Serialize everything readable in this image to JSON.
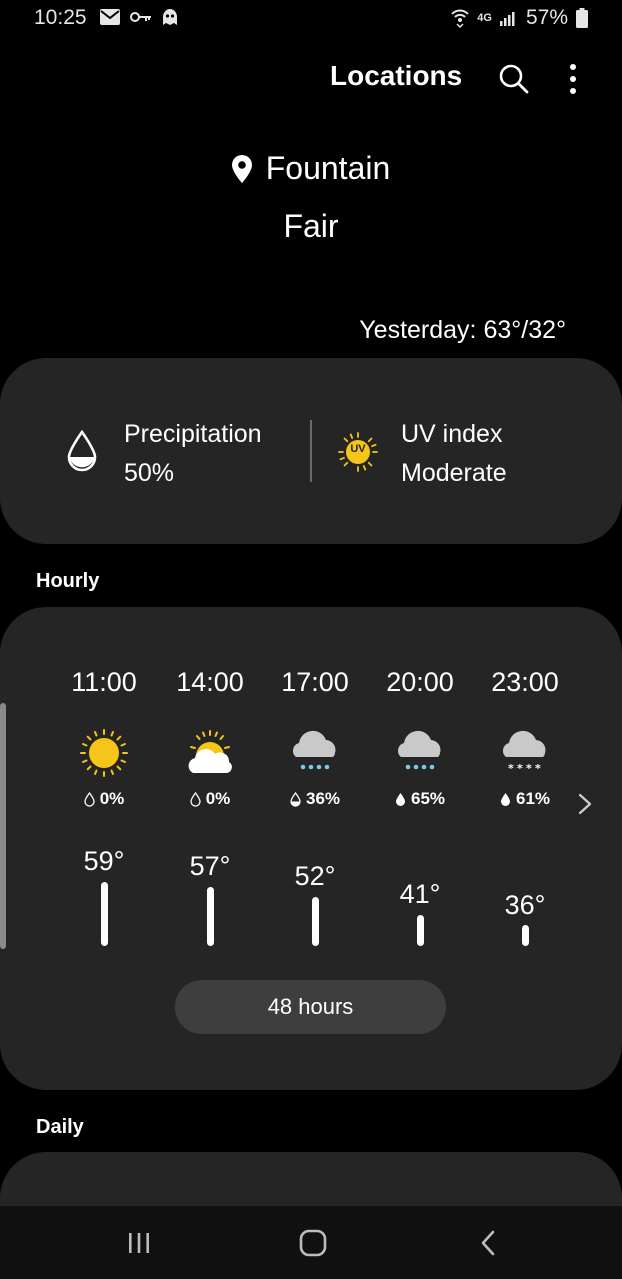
{
  "status_bar": {
    "time": "10:25",
    "network": "4G",
    "battery": "57%"
  },
  "header": {
    "title": "Locations"
  },
  "location": {
    "name": "Fountain",
    "condition": "Fair",
    "yesterday": "Yesterday: 63°/32°"
  },
  "info": {
    "precipitation_label": "Precipitation",
    "precipitation_value": "50%",
    "uv_label": "UV index",
    "uv_value": "Moderate",
    "uv_badge": "UV"
  },
  "hourly": {
    "title": "Hourly",
    "hours": [
      {
        "time": "11:00",
        "icon": "sun-icon",
        "precip": "0%",
        "temp": "59°"
      },
      {
        "time": "14:00",
        "icon": "partly-cloudy-icon",
        "precip": "0%",
        "temp": "57°"
      },
      {
        "time": "17:00",
        "icon": "rain-icon",
        "precip": "36%",
        "temp": "52°"
      },
      {
        "time": "20:00",
        "icon": "rain-icon",
        "precip": "65%",
        "temp": "41°"
      },
      {
        "time": "23:00",
        "icon": "snow-icon",
        "precip": "61%",
        "temp": "36°"
      }
    ],
    "button_label": "48 hours"
  },
  "daily": {
    "title": "Daily"
  },
  "colors": {
    "background": "#000000",
    "card": "#252525",
    "button": "#3e3e3e",
    "sun": "#f5c518"
  }
}
